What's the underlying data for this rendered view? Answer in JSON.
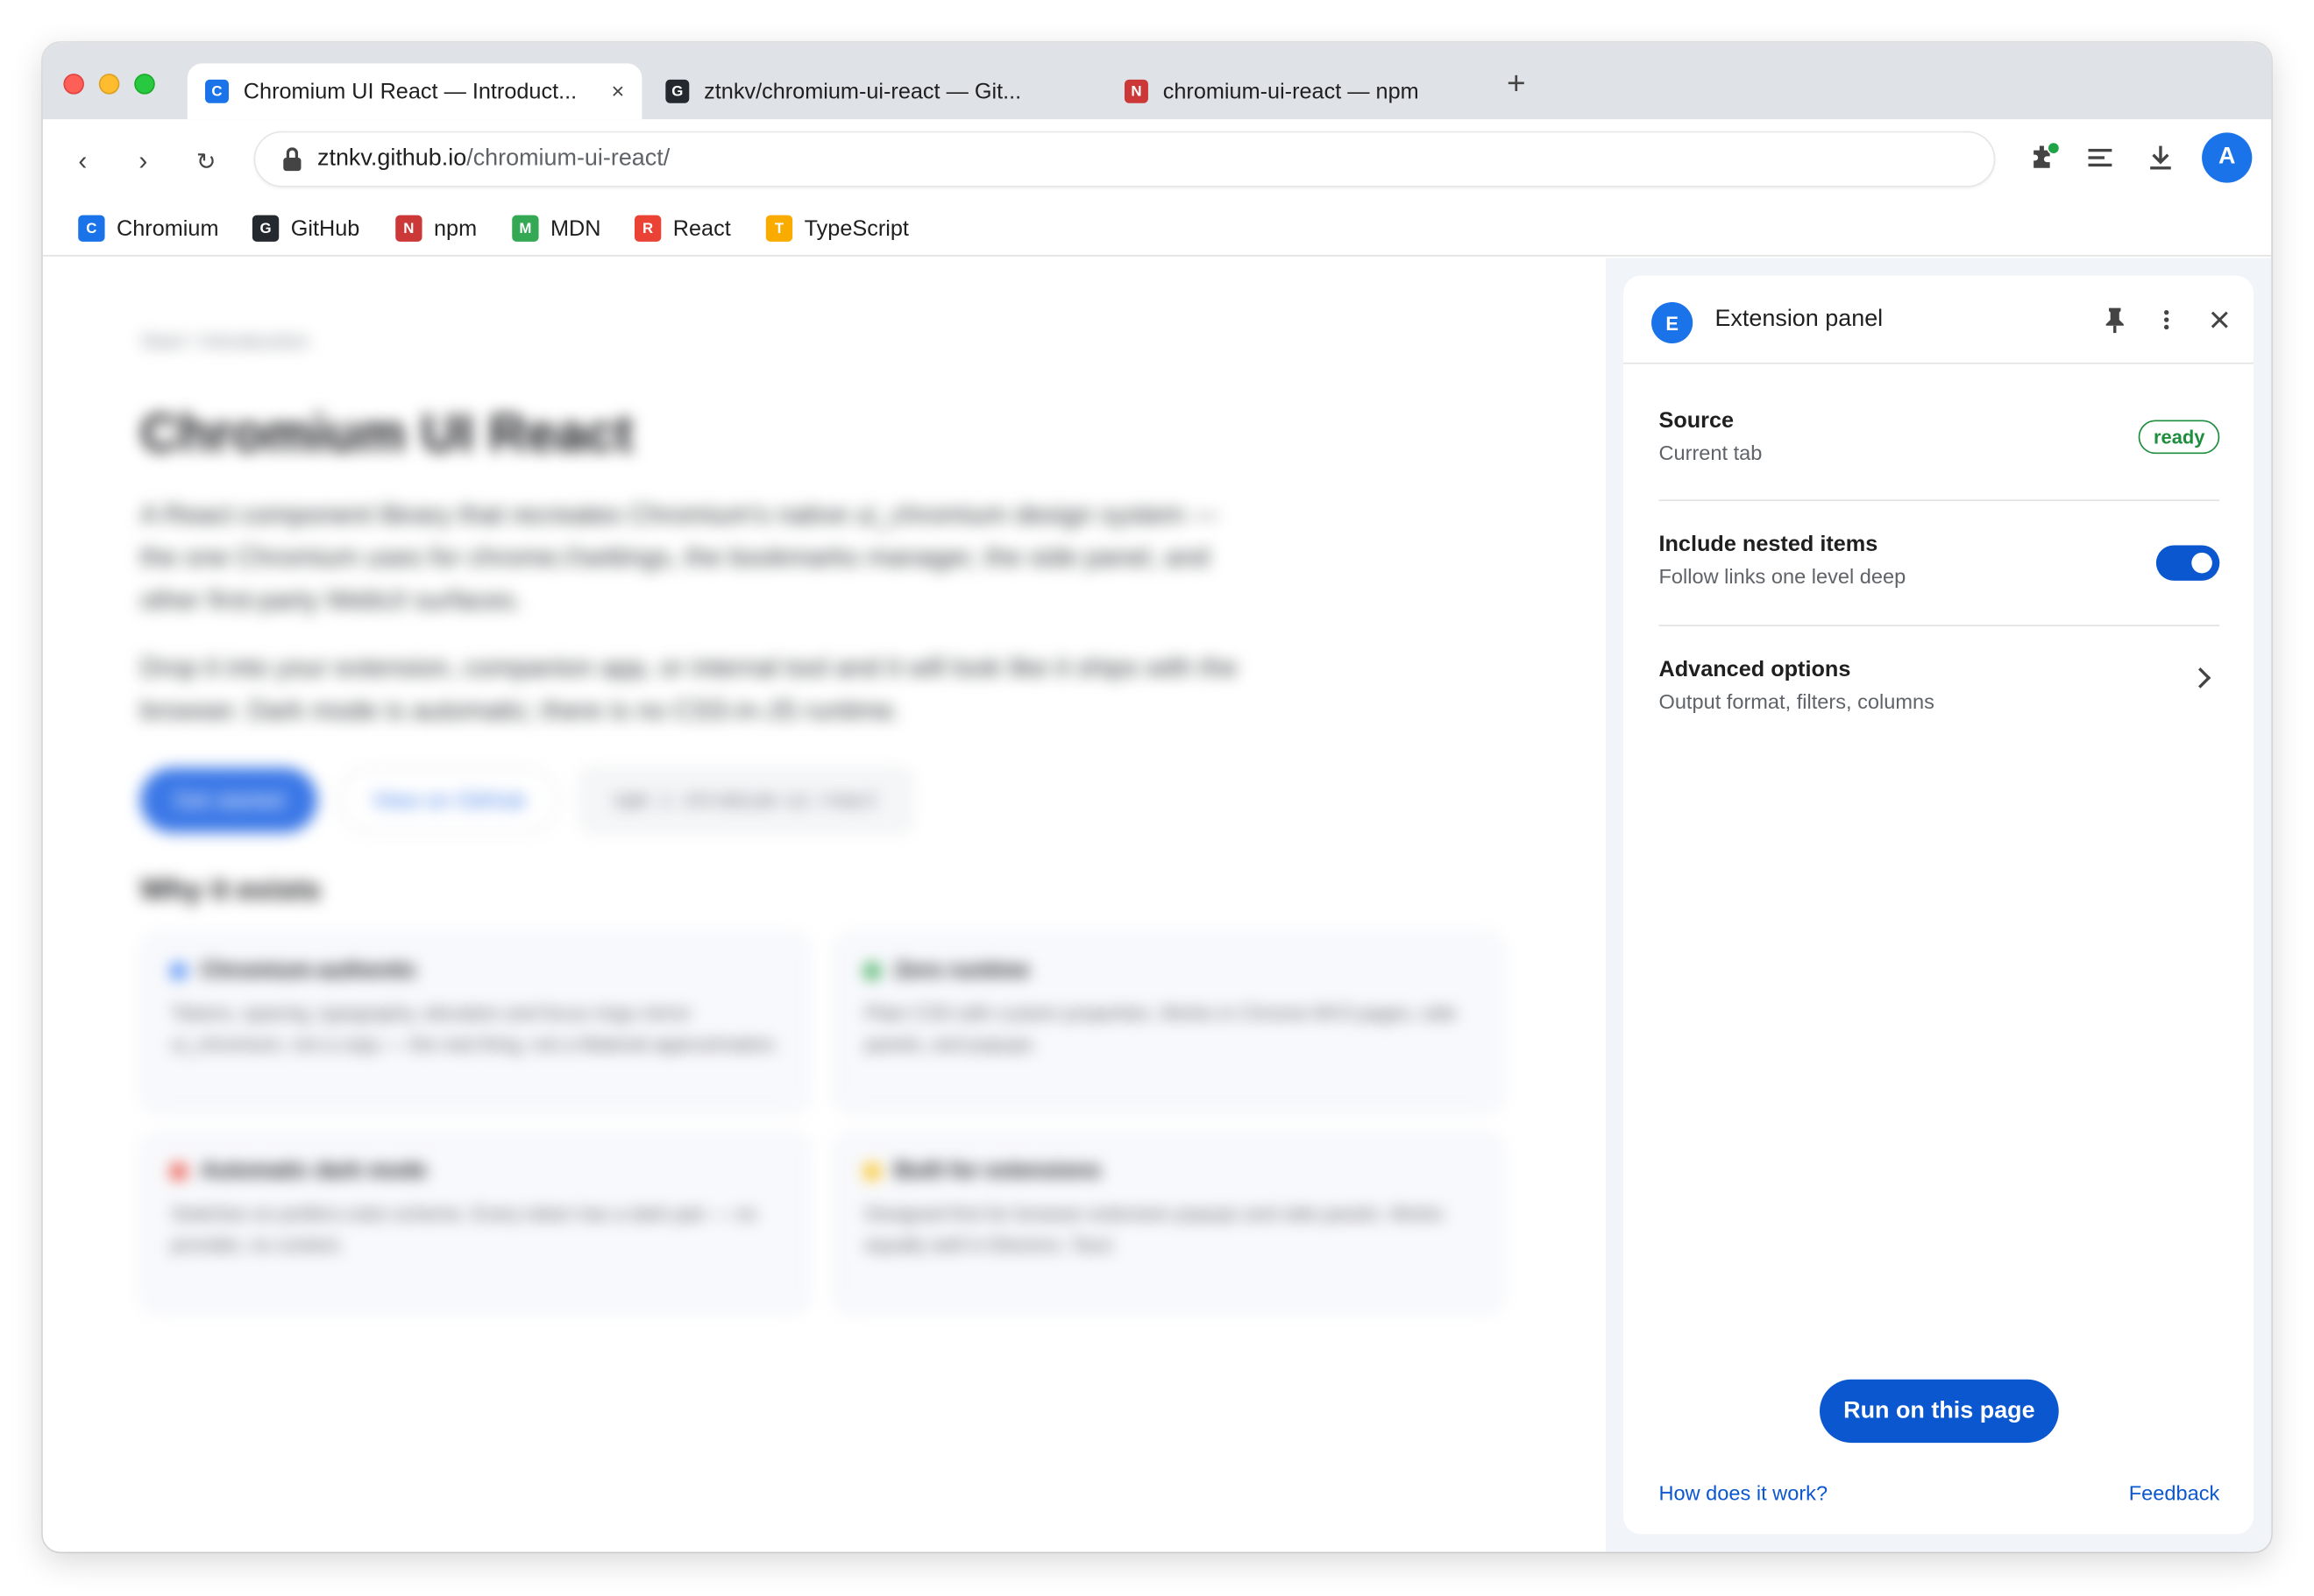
{
  "browser": {
    "tabs": [
      {
        "favicon": "C",
        "favicon_color": "#1a73e8",
        "title": "Chromium UI React — Introduct...",
        "close": "×",
        "active": true
      },
      {
        "favicon": "G",
        "favicon_color": "#24292f",
        "title": "ztnkv/chromium-ui-react — Git...",
        "active": false
      },
      {
        "favicon": "N",
        "favicon_color": "#cb3837",
        "title": "chromium-ui-react — npm",
        "active": false
      }
    ],
    "new_tab": "+",
    "nav": {
      "back": "‹",
      "forward": "›",
      "reload": "↻"
    },
    "omnibox": {
      "host": "ztnkv.github.io",
      "path": "/chromium-ui-react/"
    },
    "toolbar_icons": [
      "extensions-icon",
      "reading-list-icon",
      "download-icon"
    ],
    "avatar": "A",
    "accent": "#1a73e8"
  },
  "bookmarks": [
    {
      "favicon": "C",
      "color": "#1a73e8",
      "label": "Chromium"
    },
    {
      "favicon": "G",
      "color": "#24292f",
      "label": "GitHub"
    },
    {
      "favicon": "N",
      "color": "#cb3837",
      "label": "npm"
    },
    {
      "favicon": "M",
      "color": "#34a853",
      "label": "MDN"
    },
    {
      "favicon": "R",
      "color": "#ea4335",
      "label": "React"
    },
    {
      "favicon": "T",
      "color": "#f9ab00",
      "label": "TypeScript"
    }
  ],
  "page": {
    "breadcrumb": "Start / Introduction",
    "title": "Chromium UI React",
    "para1": "A React component library that recreates Chromium's native ui_chromium design system — the one Chromium uses for chrome://settings, the bookmarks manager, the side panel, and other first-party WebUI surfaces.",
    "para2": "Drop it into your extension, companion app, or internal tool and it will look like it ships with the browser. Dark mode is automatic; there is no CSS-in-JS runtime.",
    "btn_primary": "Get started",
    "btn_secondary": "View on GitHub",
    "install_cmd": "npm i chromium-ui-react",
    "why_heading": "Why it exists",
    "cards": [
      {
        "title": "Chromium-authentic",
        "color": "#4285f4",
        "body": "Tokens, spacing, typography, elevation and focus rings mirror ui_chromium, not a copy — the real thing, not a Material approximation."
      },
      {
        "title": "Zero runtime",
        "color": "#34a853",
        "body": "Plain CSS with custom properties. Works in Chrome MV3 pages, side panels, and popups."
      },
      {
        "title": "Automatic dark mode",
        "color": "#ea4335",
        "body": "Switches on prefers-color-scheme. Every token has a dark pair — no provider, no context."
      },
      {
        "title": "Built for extensions",
        "color": "#fbbc04",
        "body": "Designed first for browser extension popups and side panels. Works equally well in Electron, Tauri."
      }
    ]
  },
  "side_panel": {
    "icon": "E",
    "title": "Extension panel",
    "header_icons": [
      "pin-icon",
      "more-vert-icon",
      "close-icon"
    ],
    "source_title": "Source",
    "source_sub": "Current tab",
    "source_badge": "ready",
    "nested_title": "Include nested items",
    "nested_sub": "Follow links one level deep",
    "nested_enabled": true,
    "advanced_title": "Advanced options",
    "advanced_sub": "Output format, filters, columns",
    "run_button": "Run on this page",
    "help_link": "How does it work?",
    "feedback_link": "Feedback",
    "badge_color": "#1e8e3e",
    "primary_color": "#0b57d0"
  }
}
